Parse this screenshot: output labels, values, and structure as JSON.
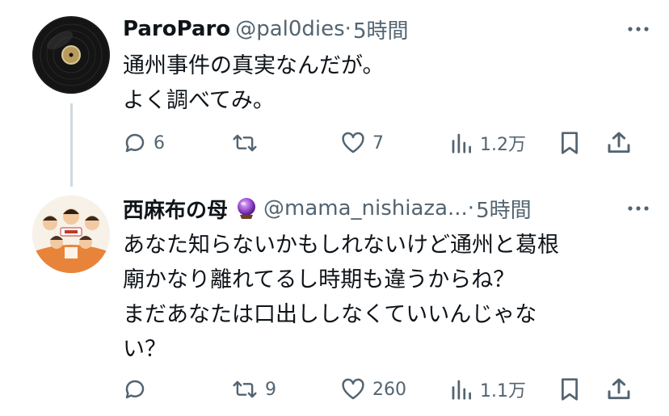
{
  "tweets": [
    {
      "name": "ParoParo",
      "handle": "@pal0dies",
      "dot": "·",
      "time": "5時間",
      "text": "通州事件の真実なんだが。\nよく調べてみ。",
      "replies": "6",
      "retweets": "",
      "likes": "7",
      "views": "1.2万",
      "avatar_icon": "vinyl-record-avatar"
    },
    {
      "name": "西麻布の母",
      "badge_icon": "crystal-ball-icon",
      "handle": "@mama_nishiaza...",
      "dot": "·",
      "time": "5時間",
      "text": "あなた知らないかもしれないけど通州と葛根\n廟かなり離れてるし時期も違うからね？\nまだあなたは口出ししなくていいんじゃな\nい？",
      "replies": "",
      "retweets": "9",
      "likes": "260",
      "views": "1.1万",
      "avatar_icon": "illustrated-group-avatar"
    }
  ],
  "colors": {
    "text": "#0f1419",
    "secondary": "#536471",
    "thread_line": "#cfd9de"
  }
}
